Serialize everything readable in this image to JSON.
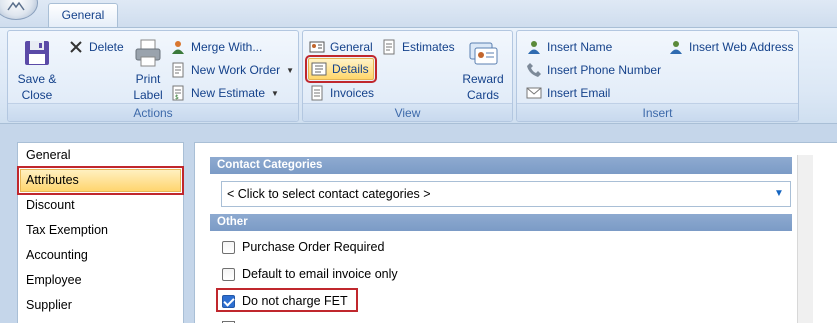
{
  "ribbon": {
    "tab": "General",
    "groups": {
      "actions": {
        "label": "Actions",
        "save_close": "Save &\nClose",
        "delete": "Delete",
        "print_label": "Print\nLabel",
        "merge_with": "Merge With...",
        "new_work_order": "New Work Order",
        "new_estimate": "New Estimate"
      },
      "view": {
        "label": "View",
        "general": "General",
        "estimates": "Estimates",
        "details": "Details",
        "invoices": "Invoices",
        "reward_cards": "Reward\nCards"
      },
      "insert": {
        "label": "Insert",
        "insert_name": "Insert Name",
        "insert_web": "Insert Web Address",
        "insert_phone": "Insert Phone Number",
        "insert_email": "Insert Email"
      }
    }
  },
  "nav": [
    "General",
    "Attributes",
    "Discount",
    "Tax Exemption",
    "Accounting",
    "Employee",
    "Supplier"
  ],
  "nav_selected": "Attributes",
  "form": {
    "contact_categories_header": "Contact Categories",
    "contact_categories_value": "< Click to select contact categories >",
    "other_header": "Other",
    "purchase_order_required": {
      "label": "Purchase Order Required",
      "checked": false
    },
    "email_invoice_only": {
      "label": "Default to email invoice only",
      "checked": false
    },
    "do_not_charge_fet": {
      "label": "Do not charge FET",
      "checked": true
    }
  }
}
